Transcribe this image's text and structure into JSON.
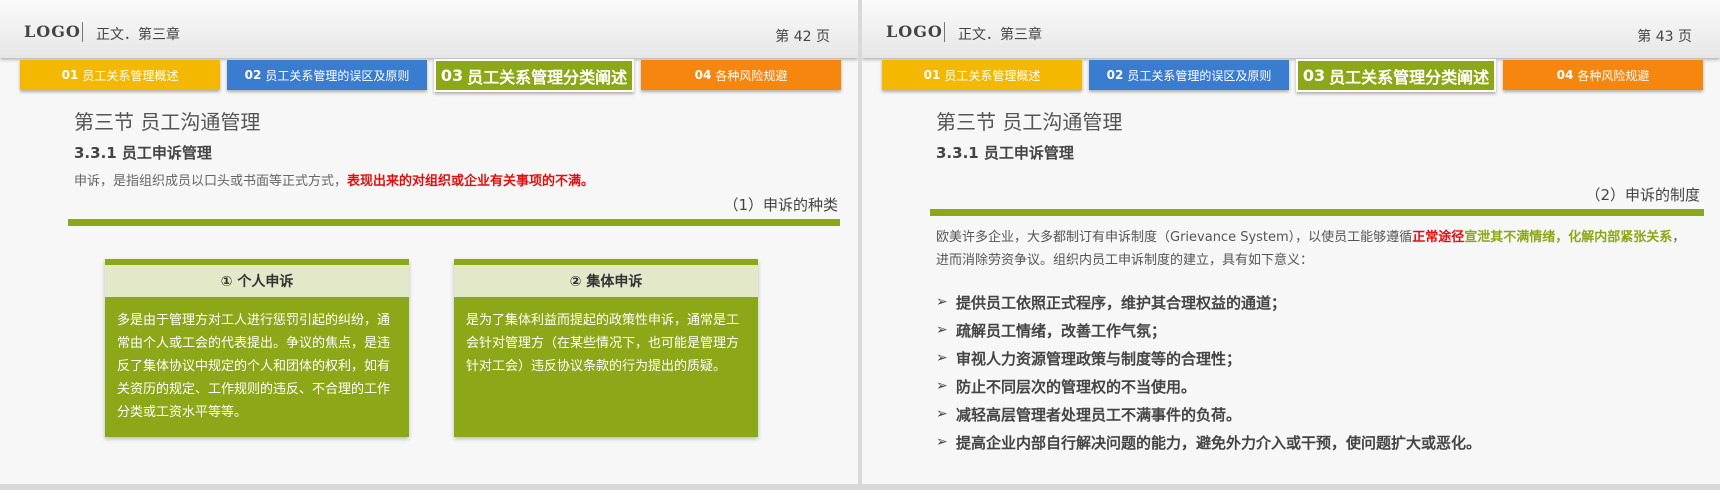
{
  "logo": "LOGO",
  "tabs": [
    {
      "num": "01",
      "label": "员工关系管理概述",
      "color": "#f5b800"
    },
    {
      "num": "02",
      "label": "员工关系管理的误区及原则",
      "color": "#3a7cd0"
    },
    {
      "num": "03",
      "label": "员工关系管理分类阐述",
      "color": "#8ca818"
    },
    {
      "num": "04",
      "label": "各种风险规避",
      "color": "#f7860e"
    }
  ],
  "left": {
    "chapter": "正文．第三章",
    "page": "第 42 页",
    "section_title": "第三节  员工沟通管理",
    "subsection": "3.3.1 员工申诉管理",
    "intro_plain": "申诉，是指组织成员以口头或书面等正式方式，",
    "intro_highlight": "表现出来的对组织或企业有关事项的不满。",
    "sub_heading": "（1）申诉的种类",
    "cards": [
      {
        "title": "① 个人申诉",
        "body": "多是由于管理方对工人进行惩罚引起的纠纷，通常由个人或工会的代表提出。争议的焦点，是违反了集体协议中规定的个人和团体的权利，如有关资历的规定、工作规则的违反、不合理的工作分类或工资水平等等。"
      },
      {
        "title": "② 集体申诉",
        "body": "是为了集体利益而提起的政策性申诉，通常是工会针对管理方（在某些情况下，也可能是管理方针对工会）违反协议条款的行为提出的质疑。"
      }
    ]
  },
  "right": {
    "chapter": "正文．第三章",
    "page": "第 43 页",
    "section_title": "第三节  员工沟通管理",
    "subsection": "3.3.1 员工申诉管理",
    "sub_heading": "（2）申诉的制度",
    "para_a": "欧美许多企业，大多都制订有申诉制度（Grievance System），以使员工能够遵循",
    "para_red": "正常途径",
    "para_green": "宣泄其不满情绪，化解内部紧张关系",
    "para_b": "，进而消除劳资争议。组织内员工申诉制度的建立，具有如下意义：",
    "bullets": [
      "提供员工依照正式程序，维护其合理权益的通道；",
      "疏解员工情绪，改善工作气氛；",
      "审视人力资源管理政策与制度等的合理性；",
      "防止不同层次的管理权的不当使用。",
      "减轻高层管理者处理员工不满事件的负荷。",
      "提高企业内部自行解决问题的能力，避免外力介入或干预，使问题扩大或恶化。"
    ]
  }
}
